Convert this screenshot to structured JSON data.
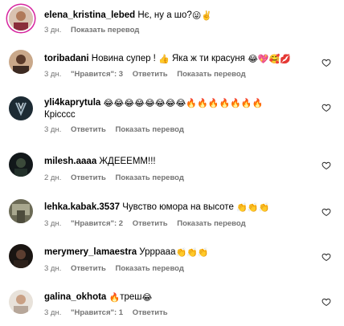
{
  "comments": [
    {
      "user": "elena_kristina_lebed",
      "text": "Нє, ну а шо?",
      "emojis": "😜✌️",
      "time": "3 дн.",
      "actions": [
        "Показать перевод"
      ]
    },
    {
      "user": "toribadani",
      "text": "Новина супер !",
      "text2": "Яка ж ти красуня",
      "emojis1": "👍",
      "emojis2": "😂💖🥰💋",
      "time": "3 дн.",
      "likes": "\"Нравится\": 3",
      "actions": [
        "Ответить",
        "Показать перевод"
      ]
    },
    {
      "user": "yli4kaprytula",
      "emojis": "😂😂😂😂😂😂😂😂🔥🔥🔥🔥🔥🔥🔥",
      "text2": "Крісссс",
      "time": "3 дн.",
      "actions": [
        "Ответить",
        "Показать перевод"
      ]
    },
    {
      "user": "milesh.aaaa",
      "text": "ЖДЕЕЕММ!!!",
      "time": "2 дн.",
      "actions": [
        "Ответить",
        "Показать перевод"
      ]
    },
    {
      "user": "lehka.kabak.3537",
      "text": "Чувство юмора на высоте",
      "emojis": "👏👏👏",
      "time": "3 дн.",
      "likes": "\"Нравится\": 2",
      "actions": [
        "Ответить",
        "Показать перевод"
      ]
    },
    {
      "user": "merymery_lamaestra",
      "text": "Урррааа",
      "emojis": "👏👏👏",
      "time": "3 дн.",
      "actions": [
        "Ответить",
        "Показать перевод"
      ]
    },
    {
      "user": "galina_okhota",
      "emojis_before": "🔥",
      "text": "треш",
      "emojis": "😂",
      "time": "3 дн.",
      "likes": "\"Нравится\": 1",
      "actions": [
        "Ответить"
      ]
    }
  ]
}
